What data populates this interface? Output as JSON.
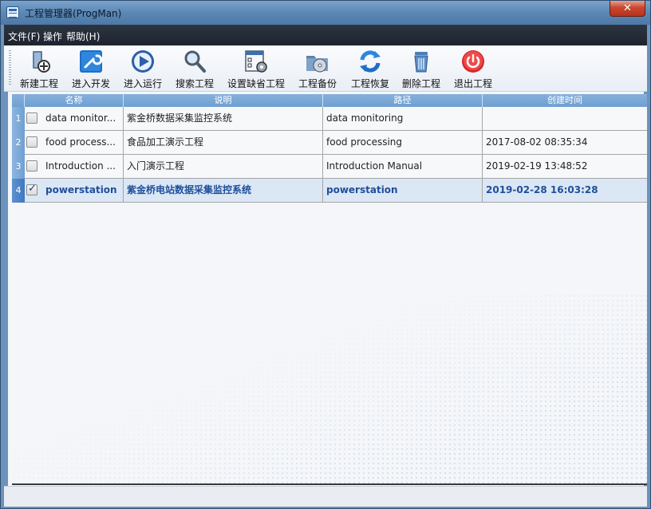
{
  "window": {
    "title": "工程管理器(ProgMan)",
    "close_label": "✕"
  },
  "menu": {
    "items": [
      "文件(F)",
      "操作",
      "帮助(H)"
    ]
  },
  "toolbar": {
    "items": [
      {
        "label": "新建工程",
        "icon": "new-project-icon"
      },
      {
        "label": "进入开发",
        "icon": "develop-wrench-icon"
      },
      {
        "label": "进入运行",
        "icon": "run-play-icon"
      },
      {
        "label": "搜索工程",
        "icon": "search-magnifier-icon"
      },
      {
        "label": "设置缺省工程",
        "icon": "default-settings-icon"
      },
      {
        "label": "工程备份",
        "icon": "backup-disc-icon"
      },
      {
        "label": "工程恢复",
        "icon": "restore-refresh-icon"
      },
      {
        "label": "删除工程",
        "icon": "trash-icon"
      },
      {
        "label": "退出工程",
        "icon": "power-exit-icon"
      }
    ]
  },
  "table": {
    "columns": [
      "名称",
      "说明",
      "路径",
      "创建时间"
    ],
    "rows": [
      {
        "num": "1",
        "checked": false,
        "name": "data monitor...",
        "desc": "紫金桥数据采集监控系统",
        "path": "data monitoring",
        "created": ""
      },
      {
        "num": "2",
        "checked": false,
        "name": "food process...",
        "desc": "食品加工演示工程",
        "path": "food processing",
        "created": "2017-08-02 08:35:34"
      },
      {
        "num": "3",
        "checked": false,
        "name": "Introduction ...",
        "desc": "入门演示工程",
        "path": "Introduction Manual",
        "created": "2019-02-19 13:48:52"
      },
      {
        "num": "4",
        "checked": true,
        "name": "powerstation",
        "desc": "紫金桥电站数据采集监控系统",
        "path": "powerstation",
        "created": "2019-02-28 16:03:28"
      }
    ]
  },
  "colors": {
    "header": "#6f9fd2",
    "selected_row": "#dbe7f5",
    "selected_text": "#1f4f9a"
  }
}
